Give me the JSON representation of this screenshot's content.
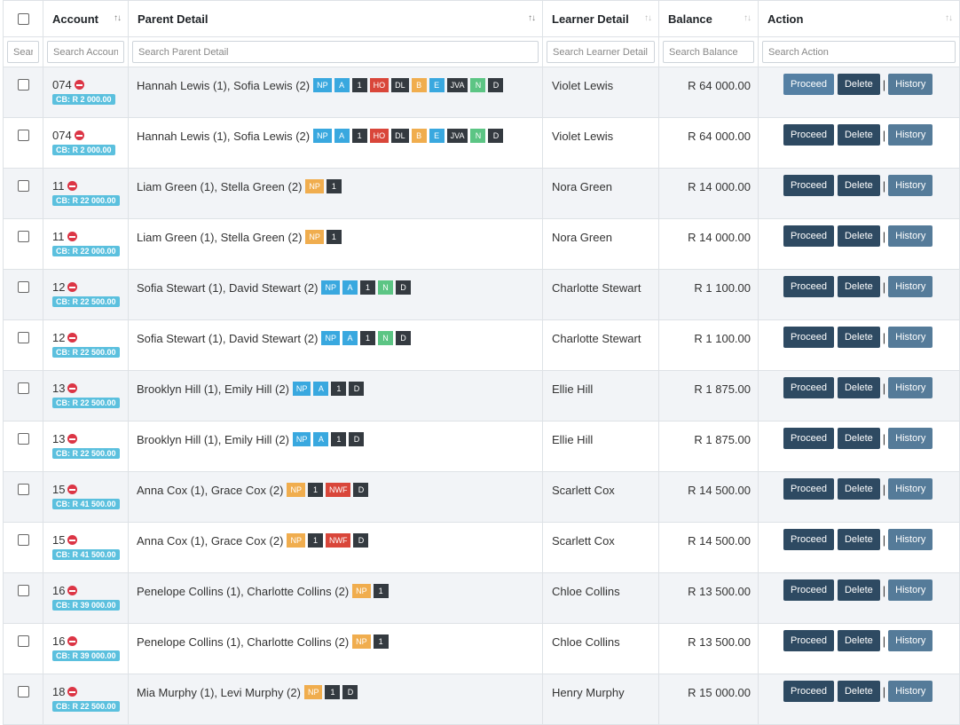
{
  "headers": {
    "account": "Account",
    "parent": "Parent Detail",
    "learner": "Learner Detail",
    "balance": "Balance",
    "action": "Action"
  },
  "filters": {
    "select_placeholder": "Search",
    "account_placeholder": "Search Account",
    "parent_placeholder": "Search Parent Detail",
    "learner_placeholder": "Search Learner Detail",
    "balance_placeholder": "Search Balance",
    "action_placeholder": "Search Action"
  },
  "buttons": {
    "proceed": "Proceed",
    "delete": "Delete",
    "history": "History",
    "separator": "|"
  },
  "badge_colors": {
    "info": "#39a8df",
    "warning": "#f0ad4e",
    "dark": "#343a40",
    "danger": "#d9463a",
    "success": "#5cc584",
    "cb": "#5bc0de"
  },
  "rows": [
    {
      "account": "074",
      "cb": "CB: R 2 000.00",
      "parents": "Hannah Lewis (1), Sofia Lewis (2)",
      "badges": [
        {
          "t": "NP",
          "c": "info"
        },
        {
          "t": "A",
          "c": "info"
        },
        {
          "t": "1",
          "c": "dark"
        },
        {
          "t": "HO",
          "c": "danger"
        },
        {
          "t": "DL",
          "c": "dark"
        },
        {
          "t": "B",
          "c": "warning"
        },
        {
          "t": "E",
          "c": "info"
        },
        {
          "t": "JVA",
          "c": "dark"
        },
        {
          "t": "N",
          "c": "success"
        },
        {
          "t": "D",
          "c": "dark"
        }
      ],
      "learner": "Violet Lewis",
      "balance": "R 64 000.00"
    },
    {
      "account": "074",
      "cb": "CB: R 2 000.00",
      "parents": "Hannah Lewis (1), Sofia Lewis (2)",
      "badges": [
        {
          "t": "NP",
          "c": "info"
        },
        {
          "t": "A",
          "c": "info"
        },
        {
          "t": "1",
          "c": "dark"
        },
        {
          "t": "HO",
          "c": "danger"
        },
        {
          "t": "DL",
          "c": "dark"
        },
        {
          "t": "B",
          "c": "warning"
        },
        {
          "t": "E",
          "c": "info"
        },
        {
          "t": "JVA",
          "c": "dark"
        },
        {
          "t": "N",
          "c": "success"
        },
        {
          "t": "D",
          "c": "dark"
        }
      ],
      "learner": "Violet Lewis",
      "balance": "R 64 000.00"
    },
    {
      "account": "11",
      "cb": "CB: R 22 000.00",
      "parents": "Liam Green (1), Stella Green (2)",
      "badges": [
        {
          "t": "NP",
          "c": "warning"
        },
        {
          "t": "1",
          "c": "dark"
        }
      ],
      "learner": "Nora Green",
      "balance": "R 14 000.00"
    },
    {
      "account": "11",
      "cb": "CB: R 22 000.00",
      "parents": "Liam Green (1), Stella Green (2)",
      "badges": [
        {
          "t": "NP",
          "c": "warning"
        },
        {
          "t": "1",
          "c": "dark"
        }
      ],
      "learner": "Nora Green",
      "balance": "R 14 000.00"
    },
    {
      "account": "12",
      "cb": "CB: R 22 500.00",
      "parents": "Sofia Stewart (1), David Stewart (2)",
      "badges": [
        {
          "t": "NP",
          "c": "info"
        },
        {
          "t": "A",
          "c": "info"
        },
        {
          "t": "1",
          "c": "dark"
        },
        {
          "t": "N",
          "c": "success"
        },
        {
          "t": "D",
          "c": "dark"
        }
      ],
      "learner": "Charlotte Stewart",
      "balance": "R 1 100.00"
    },
    {
      "account": "12",
      "cb": "CB: R 22 500.00",
      "parents": "Sofia Stewart (1), David Stewart (2)",
      "badges": [
        {
          "t": "NP",
          "c": "info"
        },
        {
          "t": "A",
          "c": "info"
        },
        {
          "t": "1",
          "c": "dark"
        },
        {
          "t": "N",
          "c": "success"
        },
        {
          "t": "D",
          "c": "dark"
        }
      ],
      "learner": "Charlotte Stewart",
      "balance": "R 1 100.00"
    },
    {
      "account": "13",
      "cb": "CB: R 22 500.00",
      "parents": "Brooklyn Hill (1), Emily Hill (2)",
      "badges": [
        {
          "t": "NP",
          "c": "info"
        },
        {
          "t": "A",
          "c": "info"
        },
        {
          "t": "1",
          "c": "dark"
        },
        {
          "t": "D",
          "c": "dark"
        }
      ],
      "learner": "Ellie Hill",
      "balance": "R 1 875.00"
    },
    {
      "account": "13",
      "cb": "CB: R 22 500.00",
      "parents": "Brooklyn Hill (1), Emily Hill (2)",
      "badges": [
        {
          "t": "NP",
          "c": "info"
        },
        {
          "t": "A",
          "c": "info"
        },
        {
          "t": "1",
          "c": "dark"
        },
        {
          "t": "D",
          "c": "dark"
        }
      ],
      "learner": "Ellie Hill",
      "balance": "R 1 875.00"
    },
    {
      "account": "15",
      "cb": "CB: R 41 500.00",
      "parents": "Anna Cox (1), Grace Cox (2)",
      "badges": [
        {
          "t": "NP",
          "c": "warning"
        },
        {
          "t": "1",
          "c": "dark"
        },
        {
          "t": "NWF",
          "c": "danger"
        },
        {
          "t": "D",
          "c": "dark"
        }
      ],
      "learner": "Scarlett Cox",
      "balance": "R 14 500.00"
    },
    {
      "account": "15",
      "cb": "CB: R 41 500.00",
      "parents": "Anna Cox (1), Grace Cox (2)",
      "badges": [
        {
          "t": "NP",
          "c": "warning"
        },
        {
          "t": "1",
          "c": "dark"
        },
        {
          "t": "NWF",
          "c": "danger"
        },
        {
          "t": "D",
          "c": "dark"
        }
      ],
      "learner": "Scarlett Cox",
      "balance": "R 14 500.00"
    },
    {
      "account": "16",
      "cb": "CB: R 39 000.00",
      "parents": "Penelope Collins (1), Charlotte Collins (2)",
      "badges": [
        {
          "t": "NP",
          "c": "warning"
        },
        {
          "t": "1",
          "c": "dark"
        }
      ],
      "learner": "Chloe Collins",
      "balance": "R 13 500.00"
    },
    {
      "account": "16",
      "cb": "CB: R 39 000.00",
      "parents": "Penelope Collins (1), Charlotte Collins (2)",
      "badges": [
        {
          "t": "NP",
          "c": "warning"
        },
        {
          "t": "1",
          "c": "dark"
        }
      ],
      "learner": "Chloe Collins",
      "balance": "R 13 500.00"
    },
    {
      "account": "18",
      "cb": "CB: R 22 500.00",
      "parents": "Mia Murphy (1), Levi Murphy (2)",
      "badges": [
        {
          "t": "NP",
          "c": "warning"
        },
        {
          "t": "1",
          "c": "dark"
        },
        {
          "t": "D",
          "c": "dark"
        }
      ],
      "learner": "Henry Murphy",
      "balance": "R 15 000.00"
    }
  ]
}
